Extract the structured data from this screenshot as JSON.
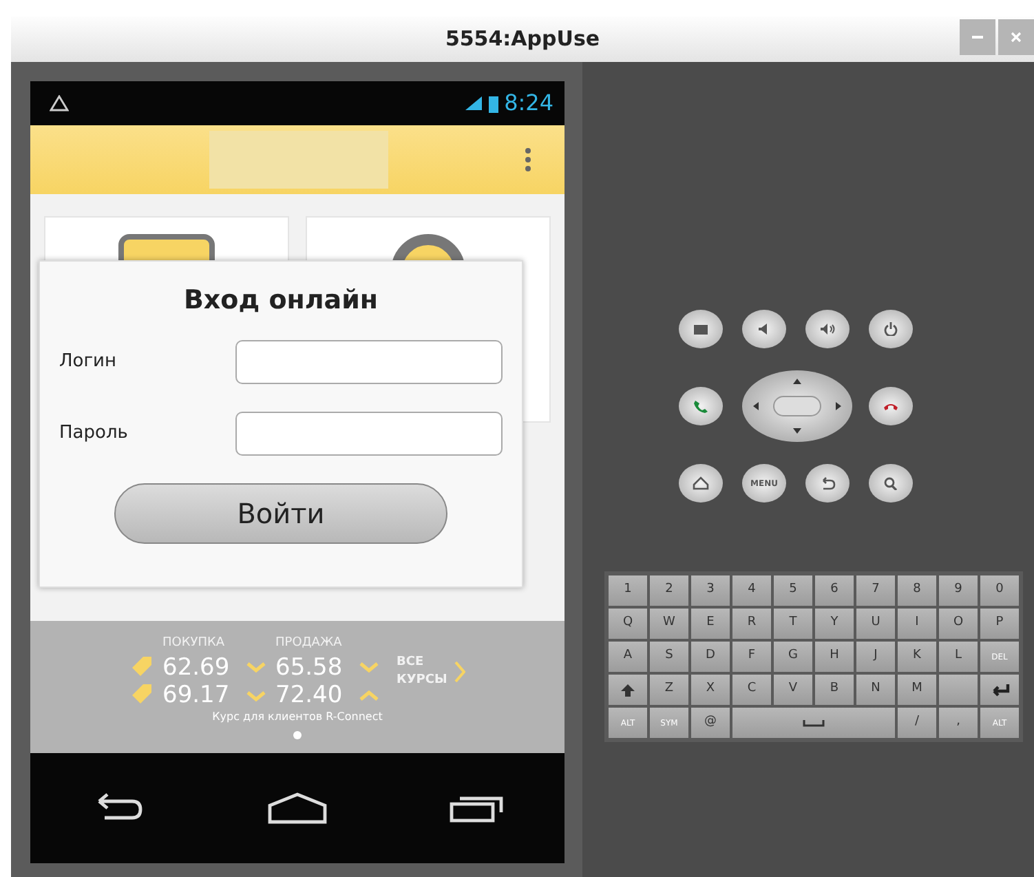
{
  "window": {
    "title": "5554:AppUse"
  },
  "status_bar": {
    "time": "8:24"
  },
  "dialog": {
    "title": "Вход онлайн",
    "fields": [
      {
        "label": "Логин"
      },
      {
        "label": "Пароль"
      }
    ],
    "button": "Войти"
  },
  "rates": {
    "headers": [
      "ПОКУПКА",
      "ПРОДАЖА"
    ],
    "rows": [
      {
        "buy": "62.69",
        "buy_rising": false,
        "sell": "65.58",
        "sell_rising": false
      },
      {
        "buy": "69.17",
        "buy_rising": false,
        "sell": "72.40",
        "sell_rising": true
      }
    ],
    "all_link": "ВСЕ КУРСЫ",
    "note": "Курс для клиентов R-Connect",
    "pages": [
      {
        "selected": true
      }
    ]
  },
  "controls": {
    "menu_label": "MENU"
  },
  "keyboard": {
    "rows": [
      [
        {
          "kind": "text",
          "label": "1"
        },
        {
          "kind": "text",
          "label": "2"
        },
        {
          "kind": "text",
          "label": "3"
        },
        {
          "kind": "text",
          "label": "4"
        },
        {
          "kind": "text",
          "label": "5"
        },
        {
          "kind": "text",
          "label": "6"
        },
        {
          "kind": "text",
          "label": "7"
        },
        {
          "kind": "text",
          "label": "8"
        },
        {
          "kind": "text",
          "label": "9"
        },
        {
          "kind": "text",
          "label": "0"
        }
      ],
      [
        {
          "kind": "text",
          "label": "Q"
        },
        {
          "kind": "text",
          "label": "W"
        },
        {
          "kind": "text",
          "label": "E"
        },
        {
          "kind": "text",
          "label": "R"
        },
        {
          "kind": "text",
          "label": "T"
        },
        {
          "kind": "text",
          "label": "Y"
        },
        {
          "kind": "text",
          "label": "U"
        },
        {
          "kind": "text",
          "label": "I"
        },
        {
          "kind": "text",
          "label": "O"
        },
        {
          "kind": "text",
          "label": "P"
        }
      ],
      [
        {
          "kind": "text",
          "label": "A"
        },
        {
          "kind": "text",
          "label": "S"
        },
        {
          "kind": "text",
          "label": "D"
        },
        {
          "kind": "text",
          "label": "F"
        },
        {
          "kind": "text",
          "label": "G"
        },
        {
          "kind": "text",
          "label": "H"
        },
        {
          "kind": "text",
          "label": "J"
        },
        {
          "kind": "text",
          "label": "K"
        },
        {
          "kind": "text",
          "label": "L"
        },
        {
          "kind": "text",
          "label": "DEL"
        }
      ],
      [
        {
          "kind": "shift"
        },
        {
          "kind": "text",
          "label": "Z"
        },
        {
          "kind": "text",
          "label": "X"
        },
        {
          "kind": "text",
          "label": "C"
        },
        {
          "kind": "text",
          "label": "V"
        },
        {
          "kind": "text",
          "label": "B"
        },
        {
          "kind": "text",
          "label": "N"
        },
        {
          "kind": "text",
          "label": "M"
        },
        {
          "kind": "blank"
        },
        {
          "kind": "enter"
        }
      ]
    ],
    "bottom_keys": [
      {
        "kind": "text",
        "label": "ALT"
      },
      {
        "kind": "text",
        "label": "SYM"
      },
      {
        "kind": "text",
        "label": "@"
      },
      {
        "kind": "space"
      },
      {
        "kind": "text",
        "label": "/"
      },
      {
        "kind": "text",
        "label": ","
      },
      {
        "kind": "text",
        "label": "ALT"
      }
    ]
  }
}
